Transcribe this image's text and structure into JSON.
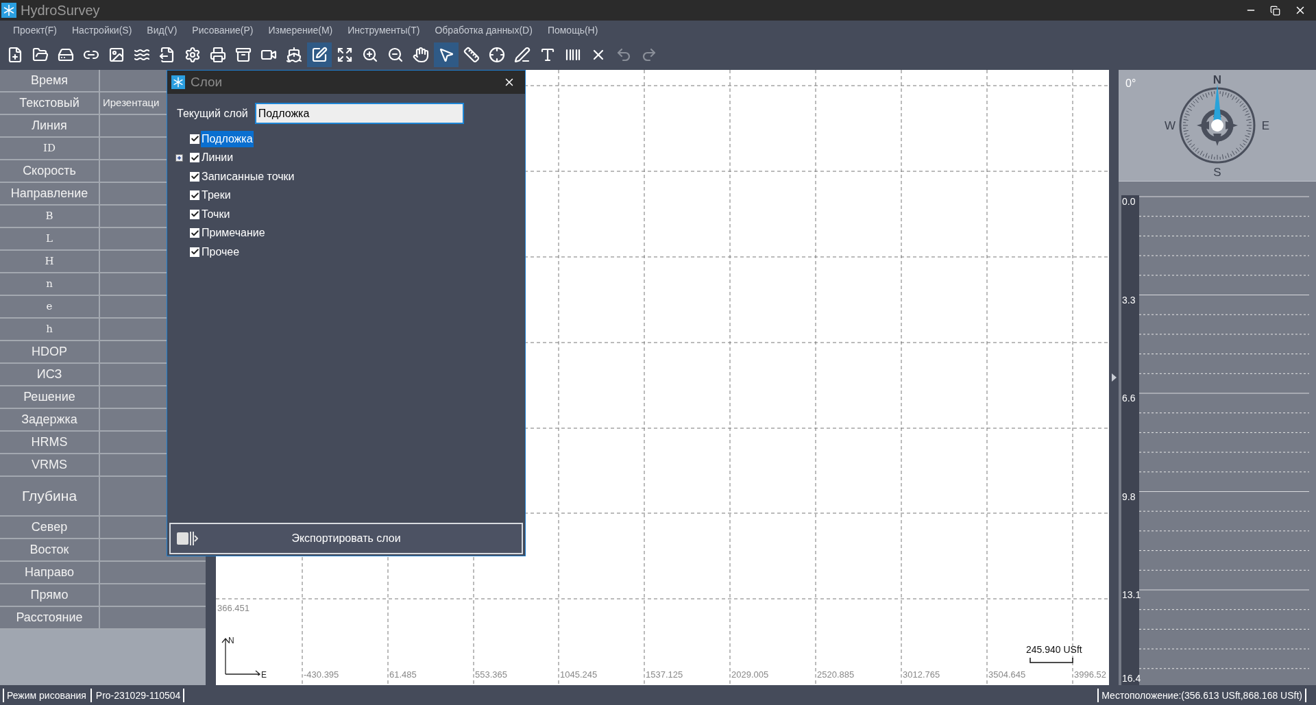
{
  "window": {
    "title": "HydroSurvey"
  },
  "menu": [
    "Проект(F)",
    "Настройки(S)",
    "Вид(V)",
    "Рисование(P)",
    "Измерение(M)",
    "Инструменты(T)",
    "Обработка данных(D)",
    "Помощь(H)"
  ],
  "toolbar": [
    {
      "kind": "new-file",
      "selected": false,
      "disabled": false
    },
    {
      "kind": "open",
      "selected": false,
      "disabled": false
    },
    {
      "kind": "drive",
      "selected": false,
      "disabled": false
    },
    {
      "kind": "link",
      "selected": false,
      "disabled": false
    },
    {
      "kind": "image",
      "selected": false,
      "disabled": false
    },
    {
      "kind": "waves",
      "selected": false,
      "disabled": false
    },
    {
      "kind": "export",
      "selected": false,
      "disabled": false
    },
    {
      "kind": "settings",
      "selected": false,
      "disabled": false
    },
    {
      "kind": "printer",
      "selected": false,
      "disabled": false
    },
    {
      "kind": "archive",
      "selected": false,
      "disabled": false
    },
    {
      "kind": "video",
      "selected": false,
      "disabled": false
    },
    {
      "kind": "ship",
      "selected": false,
      "disabled": false
    },
    {
      "kind": "edit",
      "selected": true,
      "disabled": false
    },
    {
      "kind": "expand",
      "selected": false,
      "disabled": false
    },
    {
      "kind": "zoom-in",
      "selected": false,
      "disabled": false
    },
    {
      "kind": "zoom-out",
      "selected": false,
      "disabled": false
    },
    {
      "kind": "hand",
      "selected": false,
      "disabled": false
    },
    {
      "kind": "pointer",
      "selected": true,
      "disabled": false
    },
    {
      "kind": "ruler",
      "selected": false,
      "disabled": false
    },
    {
      "kind": "crosshair",
      "selected": false,
      "disabled": false
    },
    {
      "kind": "pen-line",
      "selected": false,
      "disabled": false
    },
    {
      "kind": "text",
      "selected": false,
      "disabled": false
    },
    {
      "kind": "barcode",
      "selected": false,
      "disabled": false
    },
    {
      "kind": "delete",
      "selected": false,
      "disabled": false
    },
    {
      "kind": "undo",
      "selected": false,
      "disabled": true
    },
    {
      "kind": "redo",
      "selected": false,
      "disabled": true
    }
  ],
  "info_panel": [
    {
      "label": "Время",
      "kind": "label"
    },
    {
      "label": "Текстовый",
      "kind": "label",
      "value": "Ирезентаци"
    },
    {
      "label": "Линия",
      "kind": "label"
    },
    {
      "label": "ID",
      "kind": "mono"
    },
    {
      "label": "Скорость",
      "kind": "label"
    },
    {
      "label": "Направление",
      "kind": "label"
    },
    {
      "label": "B",
      "kind": "mono"
    },
    {
      "label": "L",
      "kind": "mono"
    },
    {
      "label": "H",
      "kind": "mono"
    },
    {
      "label": "n",
      "kind": "mono"
    },
    {
      "label": "e",
      "kind": "mono"
    },
    {
      "label": "h",
      "kind": "mono"
    },
    {
      "label": "HDOP",
      "kind": "label"
    },
    {
      "label": "ИСЗ",
      "kind": "label"
    },
    {
      "label": "Решение",
      "kind": "label"
    },
    {
      "label": "Задержка",
      "kind": "label"
    },
    {
      "label": "HRMS",
      "kind": "label"
    },
    {
      "label": "VRMS",
      "kind": "label"
    },
    {
      "label": "Глубина",
      "kind": "tall"
    },
    {
      "label": "Север",
      "kind": "label"
    },
    {
      "label": "Восток",
      "kind": "label"
    },
    {
      "label": "Направо",
      "kind": "label"
    },
    {
      "label": "Прямо",
      "kind": "label"
    },
    {
      "label": "Расстояние",
      "kind": "label"
    }
  ],
  "canvas": {
    "y_labels": [
      "366.451"
    ],
    "x_labels": [
      "-430.395",
      "61.485",
      "553.365",
      "1045.245",
      "1537.125",
      "2029.005",
      "2520.885",
      "3012.765",
      "3504.645",
      "3996.52"
    ],
    "axis": {
      "north": "N",
      "east": "E"
    },
    "scale": "245.940 USft"
  },
  "compass": {
    "heading": "0°",
    "north": "N",
    "east": "E",
    "south": "S",
    "west": "W"
  },
  "depth_scale": [
    "0.0",
    "3.3",
    "6.6",
    "9.8",
    "13.1",
    "16.4"
  ],
  "layers_dialog": {
    "title": "Слои",
    "current_layer_label": "Текущий слой",
    "current_layer": "Подложка",
    "layers": [
      {
        "label": "Подложка",
        "checked": true,
        "selected": true,
        "expandable": false
      },
      {
        "label": "Линии",
        "checked": true,
        "selected": false,
        "expandable": true
      },
      {
        "label": "Записанные точки",
        "checked": true,
        "selected": false,
        "expandable": false
      },
      {
        "label": "Треки",
        "checked": true,
        "selected": false,
        "expandable": false
      },
      {
        "label": "Точки",
        "checked": true,
        "selected": false,
        "expandable": false
      },
      {
        "label": "Примечание",
        "checked": true,
        "selected": false,
        "expandable": false
      },
      {
        "label": "Прочее",
        "checked": true,
        "selected": false,
        "expandable": false
      }
    ],
    "export_button": "Экспортировать слои"
  },
  "status_bar": {
    "mode": "Режим рисования",
    "project": "Pro-231029-110504",
    "location": "Местоположение:(356.613 USft,868.168 USft)"
  }
}
